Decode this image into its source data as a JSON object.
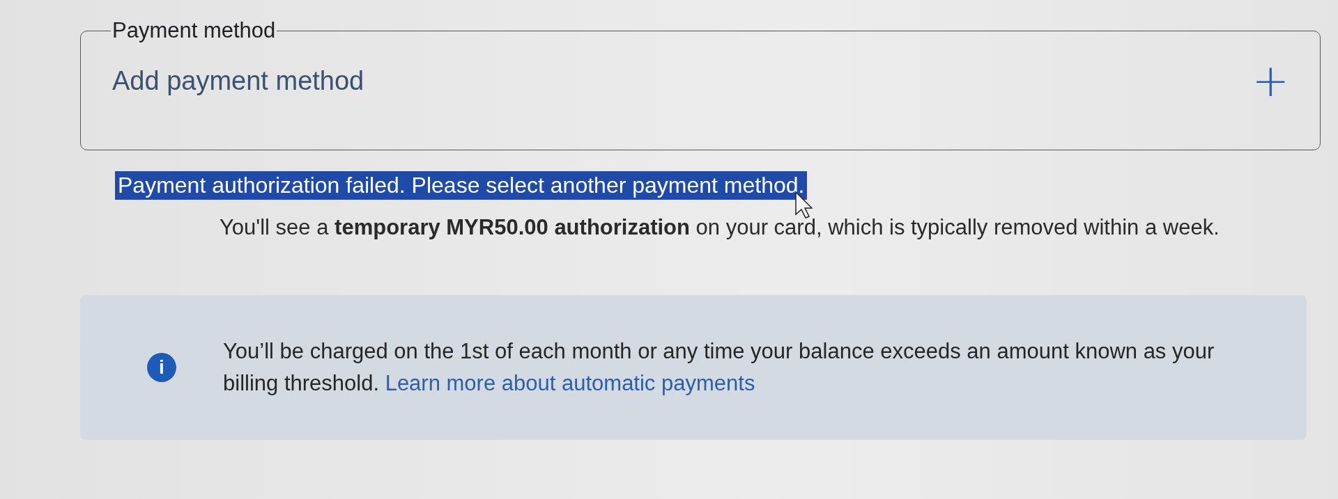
{
  "payment_method": {
    "legend": "Payment method",
    "add_label": "Add payment method",
    "add_icon": "+"
  },
  "error": {
    "text": "Payment authorization failed. Please select another payment method.",
    "highlighted": true
  },
  "note": "You'll see a **temporary MYR50.00 authorization** on your card, which is typically removed within a week.",
  "info": {
    "icon": "i",
    "text": "You’ll be charged on the 1st of each month or any time your balance exceeds an amount known as your billing threshold.",
    "link": "Learn more about automatic payments"
  }
}
